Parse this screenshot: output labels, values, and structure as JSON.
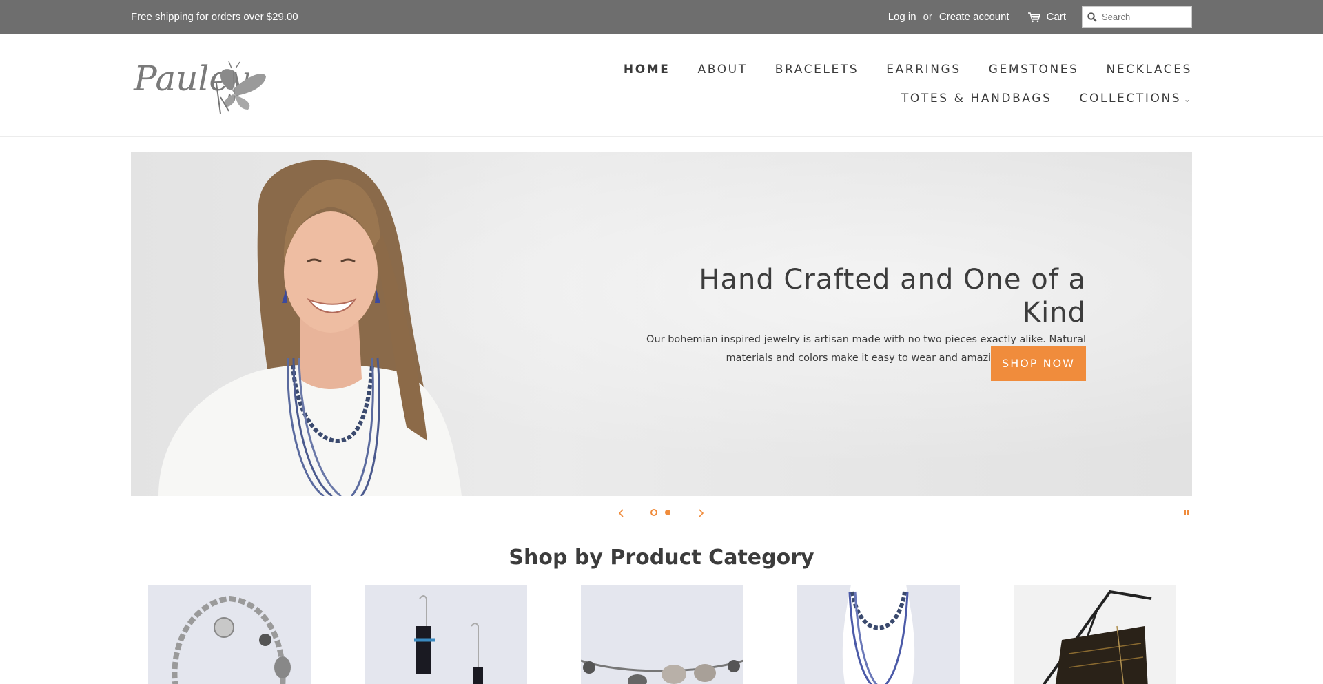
{
  "announcement": {
    "shipping_text": "Free shipping for orders over $29.00",
    "login_label": "Log in",
    "or_label": "or",
    "create_account_label": "Create account",
    "cart_label": "Cart",
    "search_placeholder": "Search"
  },
  "header": {
    "logo_text": "Pauley",
    "nav": [
      {
        "label": "HOME",
        "active": true
      },
      {
        "label": "ABOUT"
      },
      {
        "label": "BRACELETS"
      },
      {
        "label": "EARRINGS"
      },
      {
        "label": "GEMSTONES"
      },
      {
        "label": "NECKLACES"
      },
      {
        "label": "TOTES & HANDBAGS"
      },
      {
        "label": "COLLECTIONS"
      }
    ]
  },
  "hero": {
    "title": "Hand Crafted and One of a Kind",
    "description": "Our bohemian inspired jewelry is artisan made with no two pieces exactly alike. Natural materials and colors make it easy to wear and amazing to see together.",
    "button_label": "SHOP NOW",
    "slides_count": 2,
    "active_slide": 1
  },
  "categories": {
    "title": "Shop by Product Category",
    "items": [
      "bracelets",
      "earrings",
      "gemstones",
      "necklaces",
      "totes & handbags"
    ]
  },
  "colors": {
    "topbar_bg": "#6e6e6e",
    "accent": "#f08c3c",
    "text": "#3c3c3c"
  }
}
